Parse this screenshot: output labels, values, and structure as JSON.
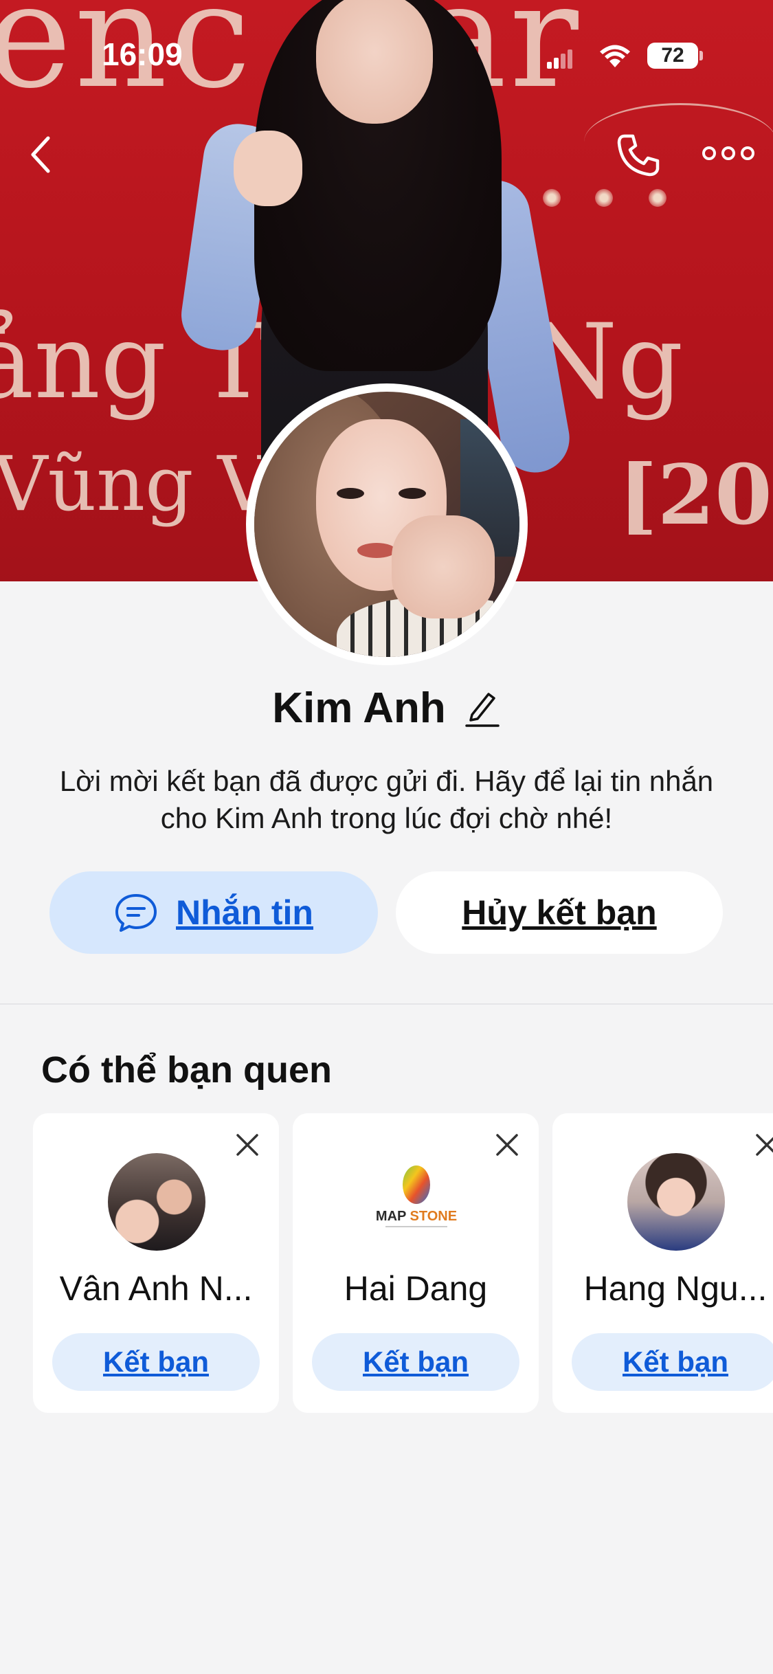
{
  "status_bar": {
    "time": "16:09",
    "battery": "72"
  },
  "profile": {
    "name": "Kim Anh",
    "note": "Lời mời kết bạn đã được gửi đi. Hãy để lại tin nhắn cho Kim Anh trong lúc đợi chờ nhé!"
  },
  "actions": {
    "message_label": "Nhắn tin",
    "unfriend_label": "Hủy kết bạn"
  },
  "suggestions": {
    "title": "Có thể bạn quen",
    "cards": [
      {
        "name": "Vân Anh N...",
        "button_label": "Kết bạn"
      },
      {
        "name": "Hai Dang",
        "button_label": "Kết bạn"
      },
      {
        "name": "Hang Ngu...",
        "button_label": "Kết bạn"
      }
    ]
  },
  "theme": {
    "accent": "#0f5bd8",
    "accent_bg": "#d6e7fd"
  }
}
